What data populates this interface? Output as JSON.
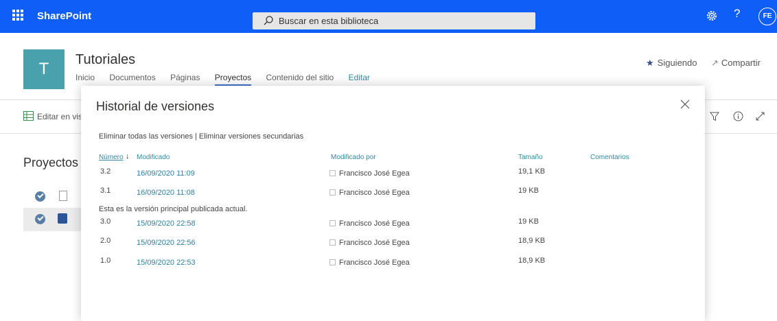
{
  "suite": {
    "brand": "SharePoint",
    "search_placeholder": "Buscar en esta biblioteca",
    "avatar": "FE",
    "help": "?",
    "brand_color": "#0f5ef7"
  },
  "site": {
    "tile_letter": "T",
    "title": "Tutoriales",
    "nav": [
      "Inicio",
      "Documentos",
      "Páginas",
      "Proyectos",
      "Contenido del sitio",
      "Editar"
    ],
    "active_nav": "Proyectos",
    "follow": "Siguiendo",
    "share": "Compartir"
  },
  "commandbar": {
    "edit_grid": "Editar en vis"
  },
  "list": {
    "title": "Proyectos"
  },
  "panel": {
    "title": "Historial de versiones",
    "links": "Eliminar todas las versiones | Eliminar versiones secundarias",
    "columns": {
      "number": "Número",
      "modified": "Modificado",
      "modified_by": "Modificado por",
      "size": "Tamaño",
      "comments": "Comentarios"
    },
    "current_note": "Esta es la versión principal publicada actual.",
    "versions": [
      {
        "version": "3.2",
        "modified": "16/09/2020 11:09",
        "user": "Francisco José Egea",
        "size": "19,1 KB"
      },
      {
        "version": "3.1",
        "modified": "16/09/2020 11:08",
        "user": "Francisco José Egea",
        "size": "19 KB"
      },
      {
        "version": "3.0",
        "modified": "15/09/2020 22:58",
        "user": "Francisco José Egea",
        "size": "19 KB"
      },
      {
        "version": "2.0",
        "modified": "15/09/2020 22:56",
        "user": "Francisco José Egea",
        "size": "18,9 KB"
      },
      {
        "version": "1.0",
        "modified": "15/09/2020 22:53",
        "user": "Francisco José Egea",
        "size": "18,9 KB"
      }
    ]
  }
}
